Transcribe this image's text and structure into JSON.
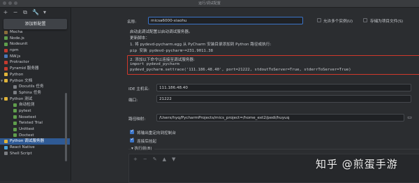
{
  "window": {
    "title": "运行/调试配置"
  },
  "toolbar": {
    "add_icon": "+",
    "remove_icon": "−",
    "copy_icon": "⧉",
    "settings_icon": "🔧",
    "more_icon": "▾"
  },
  "add_popup": {
    "label": "添加新配置"
  },
  "tree": [
    {
      "label": "Mocha",
      "indent": false,
      "color": "#8a6d3b",
      "selected": false
    },
    {
      "label": "Node.js",
      "indent": false,
      "color": "#5f9e4c",
      "selected": false
    },
    {
      "label": "Nodeunit",
      "indent": false,
      "color": "#5f9e4c",
      "selected": false
    },
    {
      "label": "npm",
      "indent": false,
      "color": "#c53b2f",
      "selected": false
    },
    {
      "label": "NW.js",
      "indent": false,
      "color": "#4a78b7",
      "selected": false
    },
    {
      "label": "Protractor",
      "indent": false,
      "color": "#c53b2f",
      "selected": false
    },
    {
      "label": "Pyramid 服务器",
      "indent": false,
      "color": "#c53b2f",
      "selected": false
    },
    {
      "label": "Python",
      "indent": false,
      "color": "#e0b43a",
      "selected": false
    },
    {
      "label": "Python 文档",
      "indent": false,
      "color": "#e0b43a",
      "selected": false,
      "expanded": true
    },
    {
      "label": "Docutils 任务",
      "indent": true,
      "color": "#7a7d82",
      "selected": false
    },
    {
      "label": "Sphinx 任务",
      "indent": true,
      "color": "#7a7d82",
      "selected": false
    },
    {
      "label": "Python 测试",
      "indent": false,
      "color": "#e0b43a",
      "selected": false,
      "expanded": true
    },
    {
      "label": "自动检测",
      "indent": true,
      "color": "#5f9e4c",
      "selected": false
    },
    {
      "label": "pytest",
      "indent": true,
      "color": "#5f9e4c",
      "selected": false
    },
    {
      "label": "Nosetest",
      "indent": true,
      "color": "#5f9e4c",
      "selected": false
    },
    {
      "label": "Twisted Trial",
      "indent": true,
      "color": "#5f9e4c",
      "selected": false
    },
    {
      "label": "Unittest",
      "indent": true,
      "color": "#5f9e4c",
      "selected": false
    },
    {
      "label": "Doctest",
      "indent": true,
      "color": "#5f9e4c",
      "selected": false
    },
    {
      "label": "Python 调试服务器",
      "indent": false,
      "color": "#e0b43a",
      "selected": true
    },
    {
      "label": "React Native",
      "indent": false,
      "color": "#4aa3d8",
      "selected": false
    },
    {
      "label": "Shell Script",
      "indent": false,
      "color": "#7a7d82",
      "selected": false
    }
  ],
  "form": {
    "name_label": "名称:",
    "name_value": "micsa6000-xiaohu",
    "allow_parallel_label": "允许多个实例(U)",
    "store_as_file_label": "存储为项目文件(S)",
    "desc_line1": "启动此调试配置以启动调试服务器。",
    "desc_line2": "更新脚本：",
    "desc_line3": "1. 将 pydevd-pycharm.egg 从 PyCharm 安装目录添加到 Python 路径或执行:",
    "desc_line4": "pip 安装 pydevd-pycharm~=231.9011.38",
    "desc_line5": "2. 添加以下命令以连接至调试服务器:",
    "code_line1": "import pydevd_pycharm",
    "code_line2": "pydevd_pycharm.settrace('111.186.48.40', port=21222, stdoutToServer=True, stderrToServer=True)",
    "ide_host_label": "IDE 主机名:",
    "ide_host_value": "111.186.48.40",
    "port_label": "端口:",
    "port_value": "21222",
    "path_map_label": "路径映射:",
    "path_map_value": "/Users/hyq/PycharmProjects/mics_project=/home_ext2/pedi/huyuq",
    "redirect_label": "将输出重定向到控制台",
    "redirect_checked": true,
    "suspend_label": "连接后挂起",
    "suspend_checked": true,
    "before_launch_label": "▾ 执行前(B)",
    "exec_add_icon": "+",
    "exec_remove_icon": "−",
    "exec_edit_icon": "✎",
    "exec_up_icon": "▲",
    "exec_down_icon": "▼"
  },
  "watermark": {
    "text": "知乎 @煎蛋手游",
    "logo": ""
  }
}
